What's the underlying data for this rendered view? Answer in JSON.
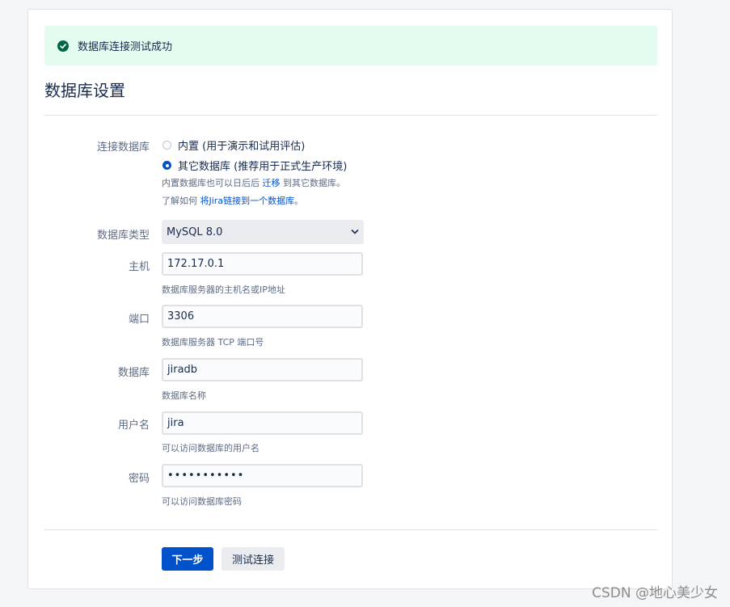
{
  "alert": {
    "message": "数据库连接测试成功",
    "icon": "check-circle-icon",
    "background": "#e3fcef",
    "icon_color": "#006644"
  },
  "page": {
    "title": "数据库设置"
  },
  "connection": {
    "label": "连接数据库",
    "options": [
      {
        "label": "内置 (用于演示和试用评估)",
        "checked": false
      },
      {
        "label": "其它数据库 (推荐用于正式生产环境)",
        "checked": true
      }
    ],
    "help1_prefix": "内置数据库也可以日后后 ",
    "help1_link": "迁移",
    "help1_suffix": " 到其它数据库。",
    "help2_prefix": "了解如何 ",
    "help2_link": "将Jira链接到一个数据库",
    "help2_suffix": "。"
  },
  "db_type": {
    "label": "数据库类型",
    "value": "MySQL 8.0"
  },
  "host": {
    "label": "主机",
    "value": "172.17.0.1",
    "help": "数据库服务器的主机名或IP地址"
  },
  "port": {
    "label": "端口",
    "value": "3306",
    "help": "数据库服务器 TCP 端口号"
  },
  "database": {
    "label": "数据库",
    "value": "jiradb",
    "help": "数据库名称"
  },
  "username": {
    "label": "用户名",
    "value": "jira",
    "help": "可以访问数据库的用户名"
  },
  "password": {
    "label": "密码",
    "value": "•••••••••••",
    "help": "可以访问数据库密码"
  },
  "buttons": {
    "next": "下一步",
    "test": "测试连接"
  },
  "colors": {
    "primary": "#0052cc",
    "border": "#dfe1e6"
  },
  "watermark": "CSDN @地心美少女"
}
